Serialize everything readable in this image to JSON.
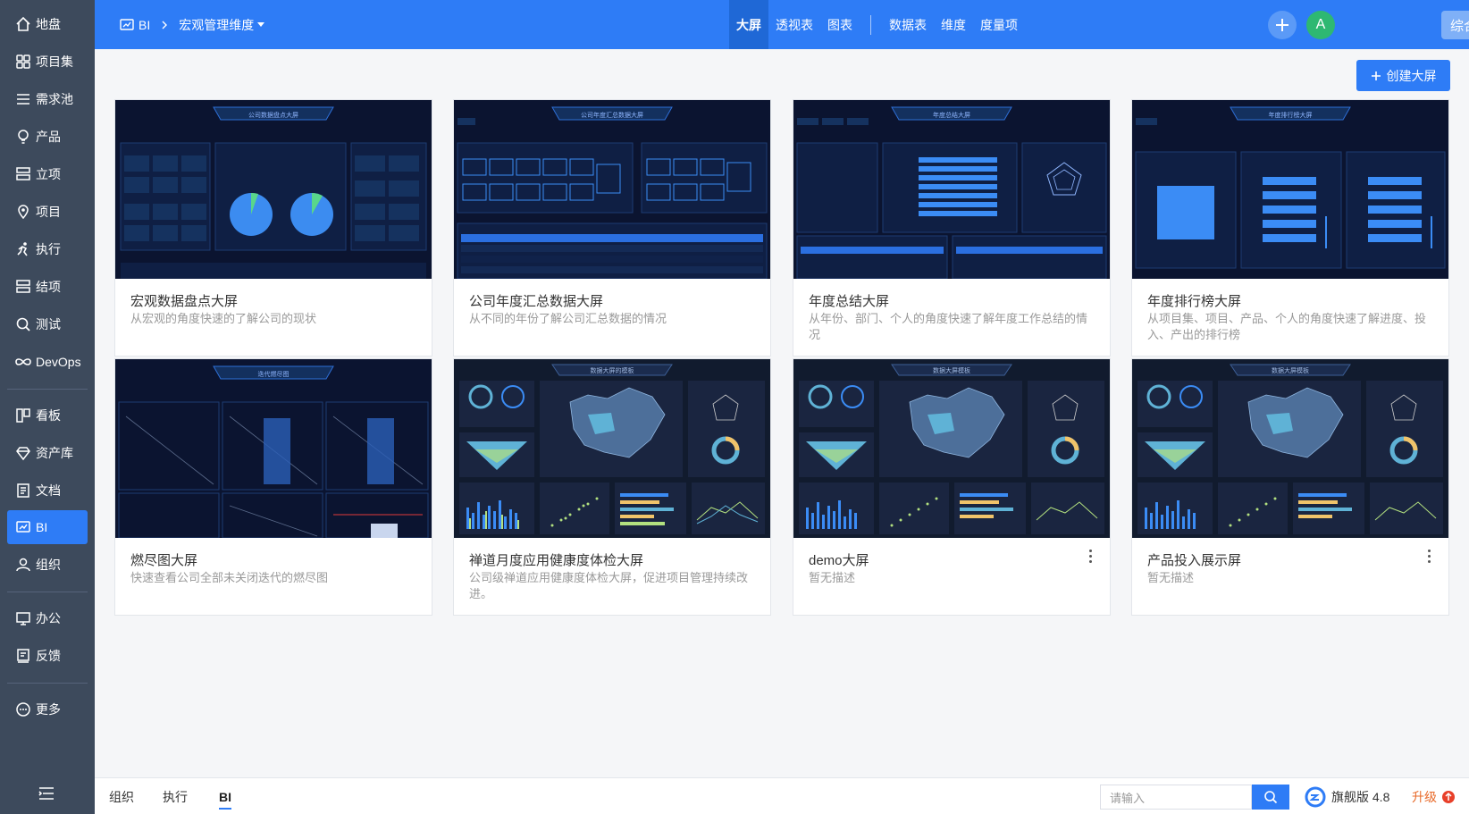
{
  "sidebar": {
    "items": [
      {
        "label": "地盘",
        "icon": "home-icon"
      },
      {
        "label": "项目集",
        "icon": "grid-icon"
      },
      {
        "label": "需求池",
        "icon": "list-icon"
      },
      {
        "label": "产品",
        "icon": "lightbulb-icon"
      },
      {
        "label": "立项",
        "icon": "stack-icon"
      },
      {
        "label": "项目",
        "icon": "location-pin-icon"
      },
      {
        "label": "执行",
        "icon": "runner-icon"
      },
      {
        "label": "结项",
        "icon": "stack-check-icon"
      },
      {
        "label": "测试",
        "icon": "magnifier-icon"
      },
      {
        "label": "DevOps",
        "icon": "infinity-icon"
      },
      {
        "label": "看板",
        "icon": "kanban-icon"
      },
      {
        "label": "资产库",
        "icon": "diamond-icon"
      },
      {
        "label": "文档",
        "icon": "document-icon"
      },
      {
        "label": "BI",
        "icon": "bi-screen-icon"
      },
      {
        "label": "组织",
        "icon": "users-icon"
      },
      {
        "label": "办公",
        "icon": "monitor-icon"
      },
      {
        "label": "反馈",
        "icon": "feedback-icon"
      },
      {
        "label": "更多",
        "icon": "more-circle-icon"
      }
    ],
    "active": "BI"
  },
  "topbar": {
    "breadcrumb_root": "BI",
    "breadcrumb_current": "宏观管理维度",
    "tabs": [
      "大屏",
      "透视表",
      "图表",
      "数据表",
      "维度",
      "度量项"
    ],
    "active_tab": "大屏",
    "avatar_letter": "A",
    "env_button": "综合研发界面"
  },
  "create_button": "创建大屏",
  "cards": [
    {
      "title": "宏观数据盘点大屏",
      "desc": "从宏观的角度快速的了解公司的现状",
      "thumb_caption": "公司数据盘点大屏"
    },
    {
      "title": "公司年度汇总数据大屏",
      "desc": "从不同的年份了解公司汇总数据的情况",
      "thumb_caption": "公司年度汇总数据大屏"
    },
    {
      "title": "年度总结大屏",
      "desc": "从年份、部门、个人的角度快速了解年度工作总结的情况",
      "thumb_caption": "年度总结大屏"
    },
    {
      "title": "年度排行榜大屏",
      "desc": "从项目集、项目、产品、个人的角度快速了解进度、投入、产出的排行榜",
      "thumb_caption": "年度排行榜大屏"
    },
    {
      "title": "燃尽图大屏",
      "desc": "快速查看公司全部未关闭迭代的燃尽图",
      "thumb_caption": "迭代燃尽图"
    },
    {
      "title": "禅道月度应用健康度体检大屏",
      "desc": "公司级禅道应用健康度体检大屏，促进项目管理持续改进。",
      "thumb_caption": "数据大屏的模板"
    },
    {
      "title": "demo大屏",
      "desc": "暂无描述",
      "thumb_caption": "数据大屏模板"
    },
    {
      "title": "产品投入展示屏",
      "desc": "暂无描述",
      "thumb_caption": "数据大屏模板"
    }
  ],
  "footer": {
    "tabs": [
      "组织",
      "执行",
      "BI"
    ],
    "active": "BI",
    "search_placeholder": "请输入",
    "version": "旗舰版 4.8",
    "upgrade": "升级"
  },
  "colors": {
    "sidebar_bg": "#3d4a5c",
    "primary": "#2e7cf6",
    "upgrade": "#e86a2a"
  }
}
